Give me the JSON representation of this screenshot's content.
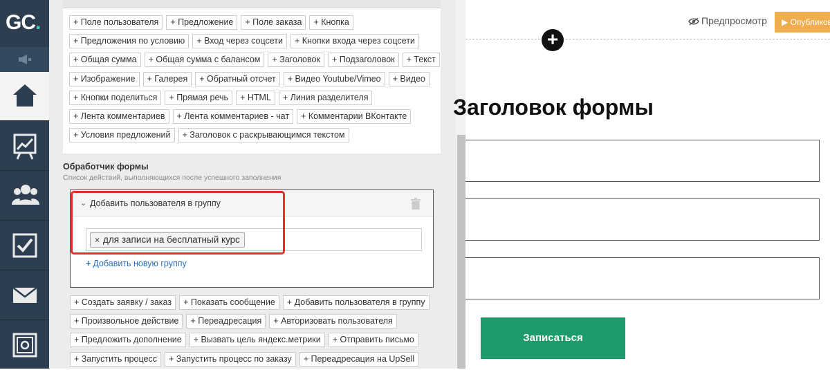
{
  "logo": {
    "text_main": "GC",
    "text_dot": "."
  },
  "sidebar": {
    "items": [
      {
        "icon": "home-icon",
        "active": true
      },
      {
        "icon": "chart-icon",
        "active": false
      },
      {
        "icon": "users-icon",
        "active": false
      },
      {
        "icon": "checkbox-icon",
        "active": false
      },
      {
        "icon": "mail-icon",
        "active": false
      },
      {
        "icon": "safe-icon",
        "active": false
      }
    ]
  },
  "fields_palette": {
    "rows": [
      [
        "+ Поле пользователя",
        "+ Предложение",
        "+ Поле заказа",
        "+ Кнопка"
      ],
      [
        "+ Предложения по условию",
        "+ Вход через соцсети",
        "+ Кнопки входа через соцсети"
      ],
      [
        "+ Общая сумма",
        "+ Общая сумма с балансом",
        "+ Заголовок",
        "+ Подзаголовок",
        "+ Текст"
      ],
      [
        "+ Изображение",
        "+ Галерея",
        "+ Обратный отсчет",
        "+ Видео Youtube/Vimeo",
        "+ Видео"
      ],
      [
        "+ Кнопки поделиться",
        "+ Прямая речь",
        "+ HTML",
        "+ Линия разделителя"
      ],
      [
        "+ Лента комментариев",
        "+ Лента комментариев - чат",
        "+ Комментарии ВКонтакте"
      ],
      [
        "+ Условия предложений",
        "+ Заголовок с раскрывающимся текстом"
      ]
    ]
  },
  "handler": {
    "title": "Обработчик формы",
    "subtitle": "Список действий, выполняющихся после успешного заполнения",
    "action": {
      "title": "Добавить пользователя в группу",
      "selected_group": "для записи на бесплатный курс",
      "add_group_label": "Добавить новую группу"
    },
    "action_rows": [
      [
        "+ Создать заявку / заказ",
        "+ Показать сообщение",
        "+ Добавить пользователя в группу"
      ],
      [
        "+ Произвольное действие",
        "+ Переадресация",
        "+ Авторизовать пользователя"
      ],
      [
        "+ Предложить дополнение",
        "+ Вызвать цель яндекс.метрики",
        "+ Отправить письмо"
      ],
      [
        "+ Запустить процесс",
        "+ Запустить процесс по заказу",
        "+ Переадресация на UpSell"
      ]
    ]
  },
  "preview": {
    "preview_label": "Предпросмотр",
    "publish_label": "▶ Опубликовать",
    "form_title": "Заголовок формы",
    "submit_label": "Записаться"
  },
  "colors": {
    "sidebar_bg": "#2c3e50",
    "accent_orange": "#f0ad4e",
    "submit_green": "#1e9b6b",
    "highlight_red": "#e0322b",
    "link_blue": "#2a6fb5"
  }
}
